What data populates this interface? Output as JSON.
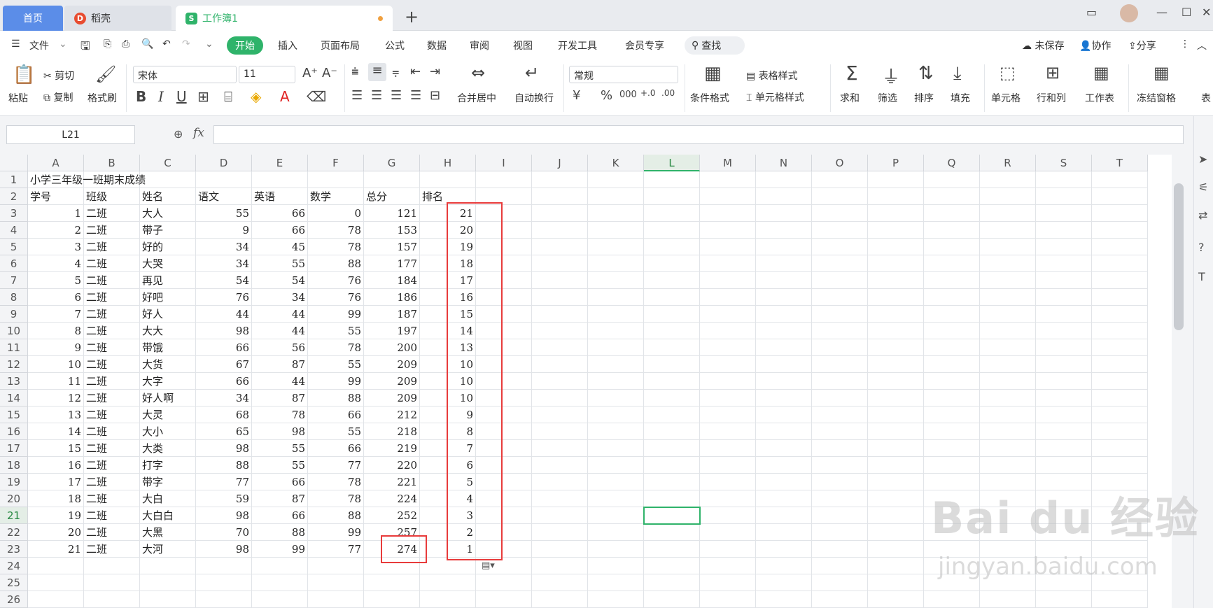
{
  "tabs": {
    "home": "首页",
    "daoke": "稻壳",
    "workbook": "工作簿1"
  },
  "menu": {
    "file": "文件",
    "items": [
      "开始",
      "插入",
      "页面布局",
      "公式",
      "数据",
      "审阅",
      "视图",
      "开发工具",
      "会员专享"
    ],
    "search": "查找",
    "unsaved": "未保存",
    "collab": "协作",
    "share": "分享"
  },
  "toolbar": {
    "paste": "粘贴",
    "cut": "剪切",
    "copy": "复制",
    "format_painter": "格式刷",
    "font_name": "宋体",
    "font_size": "11",
    "merge_center": "合并居中",
    "wrap_text": "自动换行",
    "number_format": "常规",
    "cond_format": "条件格式",
    "table_style": "表格样式",
    "cell_style": "单元格样式",
    "sum": "求和",
    "filter": "筛选",
    "sort": "排序",
    "fill": "填充",
    "cell": "单元格",
    "row_col": "行和列",
    "worksheet": "工作表",
    "freeze": "冻结窗格",
    "more": "表"
  },
  "formula_bar": {
    "name_box": "L21",
    "fx": "fx",
    "value": ""
  },
  "columns": [
    "A",
    "B",
    "C",
    "D",
    "E",
    "F",
    "G",
    "H",
    "I",
    "J",
    "K",
    "L",
    "M",
    "N",
    "O",
    "P",
    "Q",
    "R",
    "S",
    "T"
  ],
  "selected_column": "L",
  "selected_row": 21,
  "rows": [
    "1",
    "2",
    "3",
    "4",
    "5",
    "6",
    "7",
    "8",
    "9",
    "10",
    "11",
    "12",
    "13",
    "14",
    "15",
    "16",
    "17",
    "18",
    "19",
    "20",
    "21",
    "22",
    "23",
    "24",
    "25",
    "26"
  ],
  "sheet": {
    "title": "小学三年级一班期末成绩",
    "headers": [
      "学号",
      "班级",
      "姓名",
      "语文",
      "英语",
      "数学",
      "总分",
      "排名"
    ],
    "records": [
      [
        "1",
        "二班",
        "大人",
        "55",
        "66",
        "0",
        "121",
        "21"
      ],
      [
        "2",
        "二班",
        "带子",
        "9",
        "66",
        "78",
        "153",
        "20"
      ],
      [
        "3",
        "二班",
        "好的",
        "34",
        "45",
        "78",
        "157",
        "19"
      ],
      [
        "4",
        "二班",
        "大哭",
        "34",
        "55",
        "88",
        "177",
        "18"
      ],
      [
        "5",
        "二班",
        "再见",
        "54",
        "54",
        "76",
        "184",
        "17"
      ],
      [
        "6",
        "二班",
        "好吧",
        "76",
        "34",
        "76",
        "186",
        "16"
      ],
      [
        "7",
        "二班",
        "好人",
        "44",
        "44",
        "99",
        "187",
        "15"
      ],
      [
        "8",
        "二班",
        "大大",
        "98",
        "44",
        "55",
        "197",
        "14"
      ],
      [
        "9",
        "二班",
        "带饿",
        "66",
        "56",
        "78",
        "200",
        "13"
      ],
      [
        "10",
        "二班",
        "大货",
        "67",
        "87",
        "55",
        "209",
        "10"
      ],
      [
        "11",
        "二班",
        "大字",
        "66",
        "44",
        "99",
        "209",
        "10"
      ],
      [
        "12",
        "二班",
        "好人啊",
        "34",
        "87",
        "88",
        "209",
        "10"
      ],
      [
        "13",
        "二班",
        "大灵",
        "68",
        "78",
        "66",
        "212",
        "9"
      ],
      [
        "14",
        "二班",
        "大小",
        "65",
        "98",
        "55",
        "218",
        "8"
      ],
      [
        "15",
        "二班",
        "大类",
        "98",
        "55",
        "66",
        "219",
        "7"
      ],
      [
        "16",
        "二班",
        "打字",
        "88",
        "55",
        "77",
        "220",
        "6"
      ],
      [
        "17",
        "二班",
        "带字",
        "77",
        "66",
        "78",
        "221",
        "5"
      ],
      [
        "18",
        "二班",
        "大白",
        "59",
        "87",
        "78",
        "224",
        "4"
      ],
      [
        "19",
        "二班",
        "大白白",
        "98",
        "66",
        "88",
        "252",
        "3"
      ],
      [
        "20",
        "二班",
        "大黑",
        "70",
        "88",
        "99",
        "257",
        "2"
      ],
      [
        "21",
        "二班",
        "大河",
        "98",
        "99",
        "77",
        "274",
        "1"
      ]
    ]
  },
  "watermark": {
    "brand": "Bai du 经验",
    "url": "jingyan.baidu.com"
  },
  "colors": {
    "accent": "#2fb36a",
    "highlight": "#e83b3b",
    "home_tab": "#5b8de8"
  }
}
